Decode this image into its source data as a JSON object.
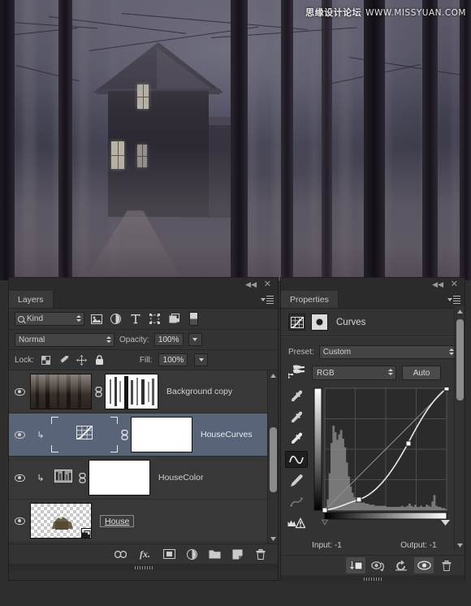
{
  "watermark": {
    "cn": "思缘设计论坛",
    "url": "WWW.MISSYUAN.COM"
  },
  "canvas": {
    "subject": "foggy-forest-with-dark-house",
    "description": "Dark wooden house seen through fog and bare tree trunks"
  },
  "layers_panel": {
    "tab_label": "Layers",
    "collapse_icon": "collapse-double-arrow-icon",
    "close_icon": "close-icon",
    "menu_icon": "panel-menu-icon",
    "filter": {
      "kind_label": "Kind",
      "search_icon": "search-icon",
      "icons": [
        "pixel-layer-filter-icon",
        "adjustment-layer-filter-icon",
        "type-layer-filter-icon",
        "shape-layer-filter-icon",
        "smart-object-filter-icon"
      ],
      "toggle_name": "filter-enable-toggle"
    },
    "blend": {
      "mode": "Normal",
      "opacity_label": "Opacity:",
      "opacity_value": "100%"
    },
    "lock": {
      "label": "Lock:",
      "icons": [
        "lock-transparent-pixels-icon",
        "lock-image-pixels-icon",
        "lock-position-icon",
        "lock-all-icon"
      ],
      "fill_label": "Fill:",
      "fill_value": "100%"
    },
    "rows": [
      {
        "name": "Background copy",
        "visible": true,
        "selected": false,
        "type": "image-with-mask",
        "has_link": true,
        "clipped": false
      },
      {
        "name": "HouseCurves",
        "visible": true,
        "selected": true,
        "type": "adjustment-curves",
        "has_link": true,
        "clipped": true
      },
      {
        "name": "HouseColor",
        "visible": true,
        "selected": false,
        "type": "adjustment-color",
        "has_link": true,
        "clipped": true
      },
      {
        "name": "House",
        "visible": true,
        "selected": false,
        "type": "smart-object",
        "has_link": false,
        "clipped": false,
        "renaming": true
      }
    ],
    "footer_icons": [
      "link-layers-icon",
      "add-layer-style-icon",
      "add-layer-mask-icon",
      "new-adjustment-layer-icon",
      "new-group-icon",
      "new-layer-icon",
      "delete-layer-icon"
    ],
    "footer_fx_label": "fx."
  },
  "properties_panel": {
    "tab_label": "Properties",
    "collapse_icon": "collapse-double-arrow-icon",
    "close_icon": "close-icon",
    "menu_icon": "panel-menu-icon",
    "header_title": "Curves",
    "header_icons": [
      "curves-adjustment-icon",
      "layer-mask-icon"
    ],
    "preset_label": "Preset:",
    "preset_value": "Custom",
    "channel_value": "RGB",
    "auto_label": "Auto",
    "on_image_icon": "on-image-adjust-icon",
    "tools": [
      "black-point-eyedropper-icon",
      "gray-point-eyedropper-icon",
      "white-point-eyedropper-icon",
      "curve-point-tool-icon",
      "pencil-draw-curve-icon",
      "smooth-curve-icon",
      "clipping-warning-icon"
    ],
    "active_tool": "curve-point-tool-icon",
    "input_label": "Input:",
    "input_value": "-1",
    "output_label": "Output:",
    "output_value": "-1",
    "footer_icons": [
      "clip-to-layer-icon",
      "view-previous-state-icon",
      "reset-icon",
      "toggle-visibility-icon",
      "delete-adjustment-icon"
    ]
  },
  "chart_data": {
    "type": "line",
    "title": "Curves",
    "xlabel": "Input",
    "ylabel": "Output",
    "xlim": [
      0,
      255
    ],
    "ylim": [
      0,
      255
    ],
    "grid": true,
    "legend": "none",
    "series": [
      {
        "name": "RGB curve",
        "points": [
          {
            "input": 0,
            "output": 0
          },
          {
            "input": 72,
            "output": 22
          },
          {
            "input": 166,
            "output": 152
          },
          {
            "input": 255,
            "output": 255
          }
        ]
      },
      {
        "name": "baseline diagonal",
        "points": [
          {
            "input": 0,
            "output": 0
          },
          {
            "input": 255,
            "output": 255
          }
        ]
      }
    ],
    "histogram": {
      "bins": 64,
      "values": [
        3,
        10,
        34,
        62,
        78,
        72,
        65,
        70,
        74,
        66,
        58,
        44,
        31,
        22,
        16,
        12,
        10,
        9,
        8,
        7,
        7,
        6,
        6,
        5,
        5,
        5,
        4,
        4,
        4,
        4,
        4,
        4,
        3,
        3,
        3,
        3,
        3,
        3,
        3,
        3,
        4,
        3,
        3,
        4,
        6,
        4,
        3,
        5,
        3,
        3,
        4,
        3,
        3,
        5,
        4,
        3,
        8,
        14,
        4,
        3,
        3,
        2,
        2,
        1
      ]
    },
    "black_point_slider": 0,
    "white_point_slider": 255,
    "input_readout": "-1",
    "output_readout": "-1"
  }
}
